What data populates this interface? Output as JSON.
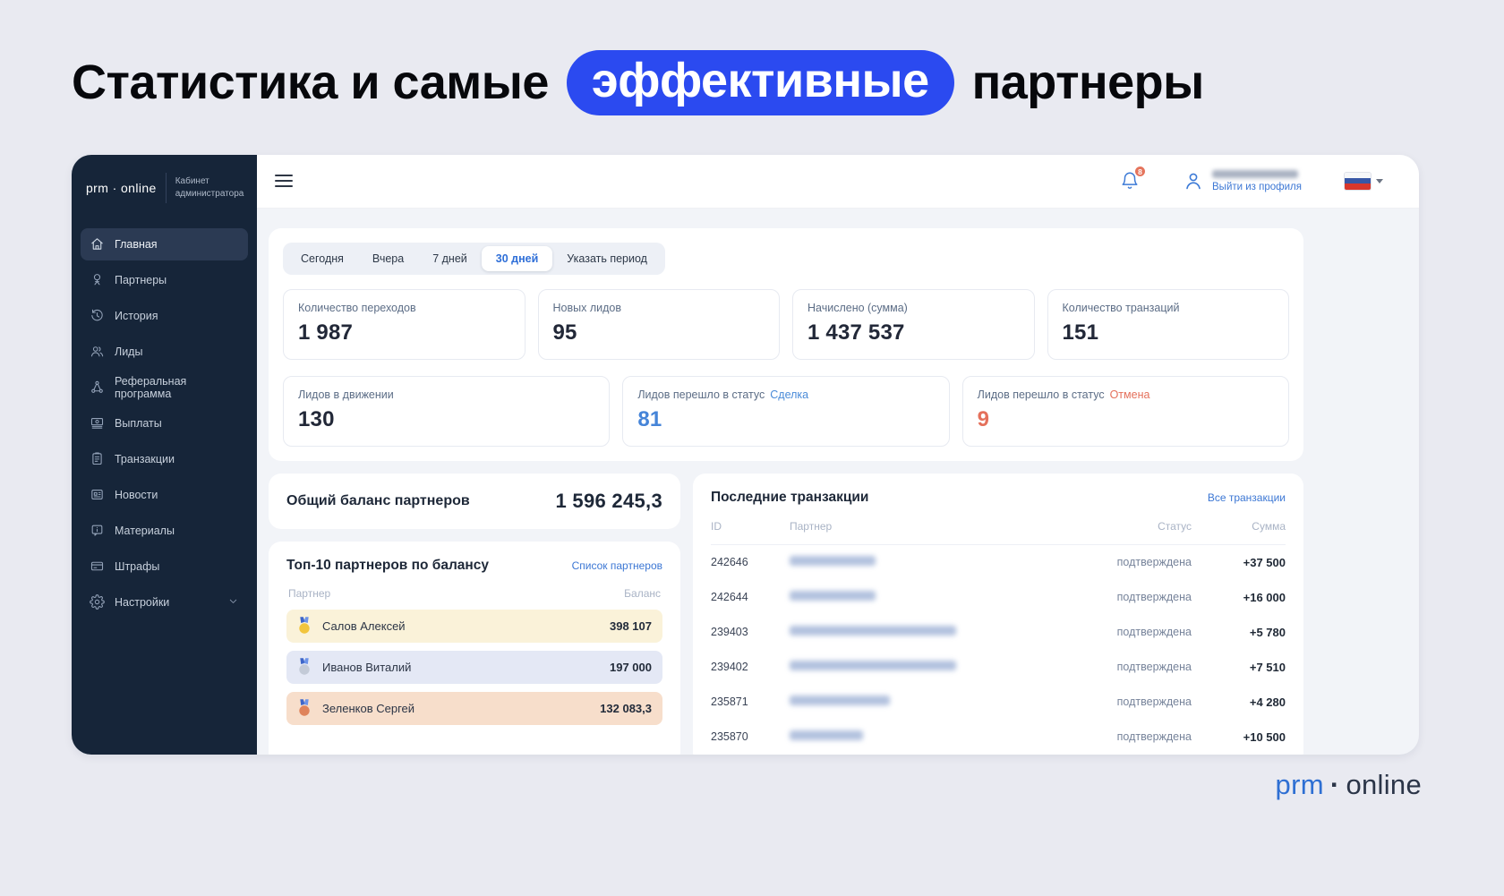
{
  "page": {
    "title": {
      "prefix": "Статистика и самые",
      "highlight": "эффективные",
      "suffix": "партнеры"
    },
    "accent_color": "#2b4af0"
  },
  "sidebar": {
    "logo": "prm · online",
    "subtitle_line1": "Кабинет",
    "subtitle_line2": "администратора",
    "items": [
      {
        "key": "glavnaya",
        "label": "Главная",
        "icon": "home-icon",
        "active": true
      },
      {
        "key": "partnery",
        "label": "Партнеры",
        "icon": "partners-tree-icon"
      },
      {
        "key": "istoriya",
        "label": "История",
        "icon": "history-clock-icon"
      },
      {
        "key": "lidy",
        "label": "Лиды",
        "icon": "leads-people-icon"
      },
      {
        "key": "referalnaya-programma",
        "label": "Реферальная программа",
        "icon": "referral-network-icon"
      },
      {
        "key": "vyplaty",
        "label": "Выплаты",
        "icon": "payouts-banknote-icon"
      },
      {
        "key": "tranzakcii",
        "label": "Транзакции",
        "icon": "transactions-clipboard-icon"
      },
      {
        "key": "novosti",
        "label": "Новости",
        "icon": "news-icon"
      },
      {
        "key": "materialy",
        "label": "Материалы",
        "icon": "materials-info-icon"
      },
      {
        "key": "shtrafy",
        "label": "Штрафы",
        "icon": "penalties-card-icon"
      },
      {
        "key": "nastroyki",
        "label": "Настройки",
        "icon": "settings-gear-icon",
        "expandable": true
      }
    ]
  },
  "topbar": {
    "notifications_count": "8",
    "logout_label": "Выйти из профиля",
    "language": "russia-flag"
  },
  "filters": {
    "tabs": [
      {
        "key": "segodnya",
        "label": "Сегодня"
      },
      {
        "key": "vchera",
        "label": "Вчера"
      },
      {
        "key": "7-dney",
        "label": "7 дней"
      },
      {
        "key": "30-dney",
        "label": "30 дней",
        "active": true
      },
      {
        "key": "ukazat-period",
        "label": "Указать период"
      }
    ]
  },
  "stats": {
    "row1": [
      {
        "key": "perehody",
        "label": "Количество переходов",
        "value": "1 987"
      },
      {
        "key": "novye-lidy",
        "label": "Новых лидов",
        "value": "95"
      },
      {
        "key": "nachisleno",
        "label": "Начислено (сумма)",
        "value": "1 437 537"
      },
      {
        "key": "tranzakcii",
        "label": "Количество транзаций",
        "value": "151"
      }
    ],
    "row2": [
      {
        "key": "lidov-v-dvizhenii",
        "label": "Лидов в движении",
        "status": "",
        "value": "130",
        "value_color": "#222838",
        "status_color": ""
      },
      {
        "key": "status-sdelka",
        "label": "Лидов перешло в статус",
        "status": "Сделка",
        "value": "81",
        "value_color": "#4584d8",
        "status_color": "#4a8bd8"
      },
      {
        "key": "status-otmena",
        "label": "Лидов перешло в статус",
        "status": "Отмена",
        "value": "9",
        "value_color": "#e4705b",
        "status_color": "#e4705b"
      }
    ]
  },
  "balance": {
    "title": "Общий баланс партнеров",
    "value": "1 596 245,3"
  },
  "top_partners": {
    "title": "Топ-10 партнеров по балансу",
    "link": "Список партнеров",
    "columns": [
      "Партнер",
      "Баланс"
    ],
    "medal_colors": {
      "gold": {
        "medal": "#f2c53d",
        "row": "#faf2d9"
      },
      "silver": {
        "medal": "#c3cad7",
        "row": "#e4e8f5"
      },
      "bronze": {
        "medal": "#df835b",
        "row": "#f7decb"
      }
    },
    "rows": [
      {
        "name": "Салов Алексей",
        "balance": "398 107",
        "medal": "gold"
      },
      {
        "name": "Иванов Виталий",
        "balance": "197 000",
        "medal": "silver"
      },
      {
        "name": "Зеленков Сергей",
        "balance": "132 083,3",
        "medal": "bronze"
      }
    ]
  },
  "transactions": {
    "title": "Последние транзакции",
    "link": "Все транзакции",
    "columns": [
      "ID",
      "Партнер",
      "Статус",
      "Сумма"
    ],
    "rows": [
      {
        "id": "242646",
        "status": "подтверждена",
        "amount": "+37 500"
      },
      {
        "id": "242644",
        "status": "подтверждена",
        "amount": "+16 000"
      },
      {
        "id": "239403",
        "status": "подтверждена",
        "amount": "+5 780"
      },
      {
        "id": "239402",
        "status": "подтверждена",
        "amount": "+7 510"
      },
      {
        "id": "235871",
        "status": "подтверждена",
        "amount": "+4 280"
      },
      {
        "id": "235870",
        "status": "подтверждена",
        "amount": "+10 500"
      }
    ]
  },
  "footer_logo": {
    "prm": "prm",
    "separator": "·",
    "online": "online"
  }
}
